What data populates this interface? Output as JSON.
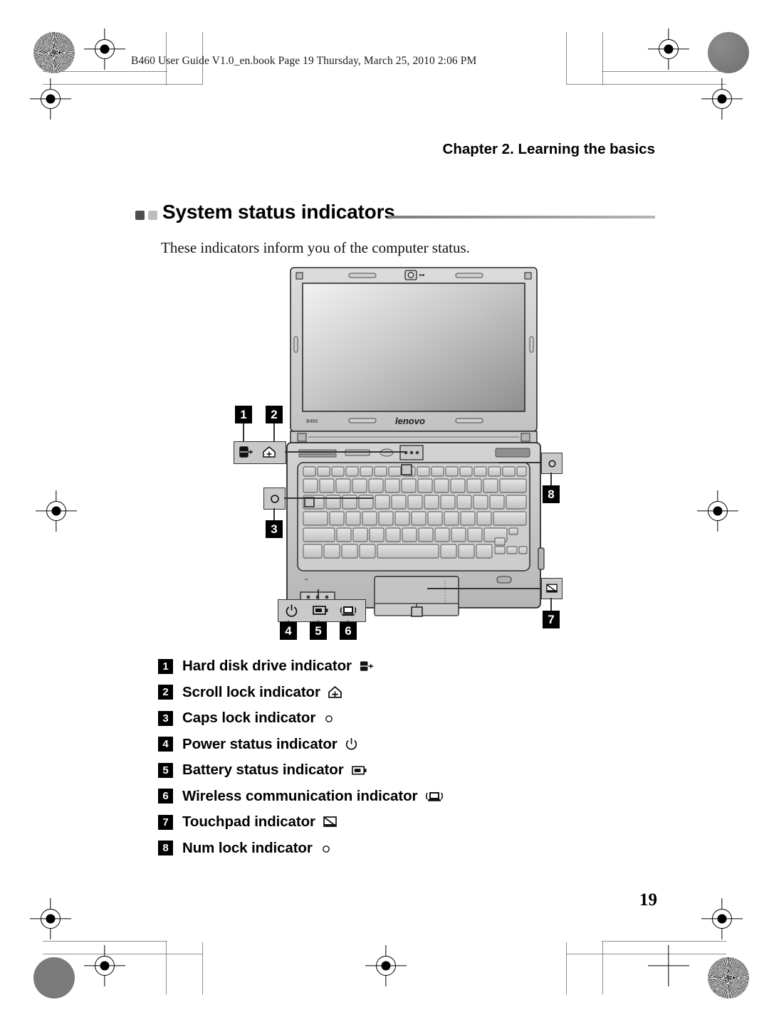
{
  "header": {
    "file_line": "B460 User Guide V1.0_en.book  Page 19  Thursday, March 25, 2010  2:06 PM"
  },
  "running_head": {
    "chapter": "Chapter 2. Learning the basics"
  },
  "section": {
    "title": "System status indicators",
    "intro": "These indicators inform you of the computer status."
  },
  "figure": {
    "model_label": "B460",
    "brand_logo": "lenovo",
    "callouts": [
      {
        "number": "1",
        "icon": "hard-disk-icon",
        "position": "top-left"
      },
      {
        "number": "2",
        "icon": "scroll-lock-icon",
        "position": "top-left"
      },
      {
        "number": "3",
        "icon": "caps-lock-icon",
        "position": "left"
      },
      {
        "number": "4",
        "icon": "power-icon",
        "position": "bottom"
      },
      {
        "number": "5",
        "icon": "battery-icon",
        "position": "bottom"
      },
      {
        "number": "6",
        "icon": "wireless-icon",
        "position": "bottom"
      },
      {
        "number": "7",
        "icon": "touchpad-icon",
        "position": "right"
      },
      {
        "number": "8",
        "icon": "num-lock-icon",
        "position": "right"
      }
    ]
  },
  "indicator_list": [
    {
      "number": "1",
      "label": "Hard disk drive indicator",
      "icon": "hard-disk-icon"
    },
    {
      "number": "2",
      "label": "Scroll lock indicator",
      "icon": "scroll-lock-icon"
    },
    {
      "number": "3",
      "label": "Caps lock indicator",
      "icon": "caps-lock-icon"
    },
    {
      "number": "4",
      "label": "Power status indicator",
      "icon": "power-icon"
    },
    {
      "number": "5",
      "label": "Battery status indicator",
      "icon": "battery-icon"
    },
    {
      "number": "6",
      "label": "Wireless communication indicator",
      "icon": "wireless-icon"
    },
    {
      "number": "7",
      "label": "Touchpad indicator",
      "icon": "touchpad-icon"
    },
    {
      "number": "8",
      "label": "Num lock indicator",
      "icon": "num-lock-icon"
    }
  ],
  "footer": {
    "page_number": "19"
  },
  "colors": {
    "bullet_dark": "#4d4d4d",
    "bullet_light": "#bdbdbd",
    "callout_bg": "#000000",
    "icon_box_bg": "#c9c9c9",
    "rule": "#8d8d8d"
  }
}
